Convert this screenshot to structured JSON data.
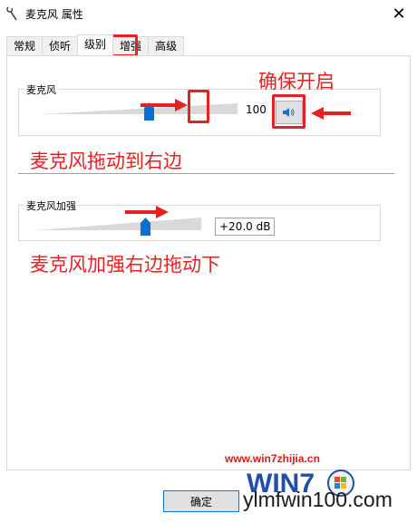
{
  "window": {
    "title": "麦克风 属性",
    "close_glyph": "✕",
    "icon": "microphone-icon"
  },
  "tabs": [
    {
      "label": "常规",
      "active": false
    },
    {
      "label": "侦听",
      "active": false
    },
    {
      "label": "级别",
      "active": true
    },
    {
      "label": "增强",
      "active": false
    },
    {
      "label": "高级",
      "active": false
    }
  ],
  "microphone": {
    "label": "麦克风",
    "level_value": "100",
    "level_fraction": 0.55,
    "speaker_icon": "speaker-icon"
  },
  "boost": {
    "label": "麦克风加强",
    "value": "+20.0 dB",
    "level_fraction": 0.66
  },
  "annotations": {
    "ensure_on": "确保开启",
    "drag_mic_right": "麦克风拖动到右边",
    "drag_boost_right": "麦克风加强右边拖动下"
  },
  "buttons": {
    "ok": "确定"
  },
  "watermark": {
    "url": "www.win7zhijia.cn",
    "site": "ylmfwin100.com",
    "logo_text": "WIN7"
  },
  "colors": {
    "annotation_red": "#e52222",
    "thumb_blue": "#0a6fd1",
    "ok_border": "#0078d7"
  }
}
